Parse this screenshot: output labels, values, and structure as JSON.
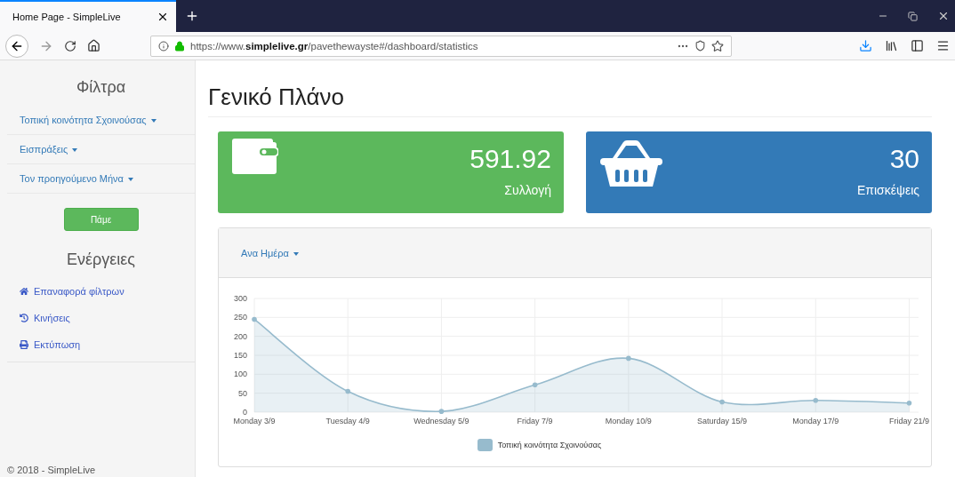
{
  "browser": {
    "tab_title": "Home Page - SimpleLive",
    "url_prefix": "https://www.",
    "url_domain": "simplelive.gr",
    "url_path": "/pavethewayste#/dashboard/statistics"
  },
  "sidebar": {
    "filters_title": "Φίλτρα",
    "filters": [
      "Τοπική κοινότητα Σχοινούσας",
      "Εισπράξεις",
      "Τον προηγούμενο Μήνα"
    ],
    "go_button": "Πάμε",
    "actions_title": "Ενέργειες",
    "actions": [
      {
        "kind": "home",
        "label": "Επαναφορά φίλτρων"
      },
      {
        "kind": "history",
        "label": "Κινήσεις"
      },
      {
        "kind": "print",
        "label": "Εκτύπωση"
      }
    ],
    "footer": "© 2018 - SimpleLive"
  },
  "main": {
    "title": "Γενικό Πλάνο",
    "cards": [
      {
        "kind": "wallet",
        "value": "591.92",
        "label": "Συλλογή",
        "color": "#5cb85c"
      },
      {
        "kind": "basket",
        "value": "30",
        "label": "Επισκέψεις",
        "color": "#337ab7"
      }
    ],
    "chart_panel": {
      "period": "Ανα Ημέρα",
      "chart_data": {
        "type": "area",
        "categories": [
          "Monday 3/9",
          "Tuesday 4/9",
          "Wednesday 5/9",
          "Friday 7/9",
          "Monday 10/9",
          "Saturday 15/9",
          "Monday 17/9",
          "Friday 21/9"
        ],
        "series": [
          {
            "name": "Τοπική κοινότητα Σχοινούσας",
            "color": "#97bbcd",
            "values": [
              245,
              55,
              2,
              72,
              142,
              27,
              31,
              24
            ]
          }
        ],
        "grid": true,
        "ylim": [
          0,
          300
        ],
        "yticks": [
          0,
          50,
          100,
          150,
          200,
          250,
          300
        ]
      }
    }
  }
}
